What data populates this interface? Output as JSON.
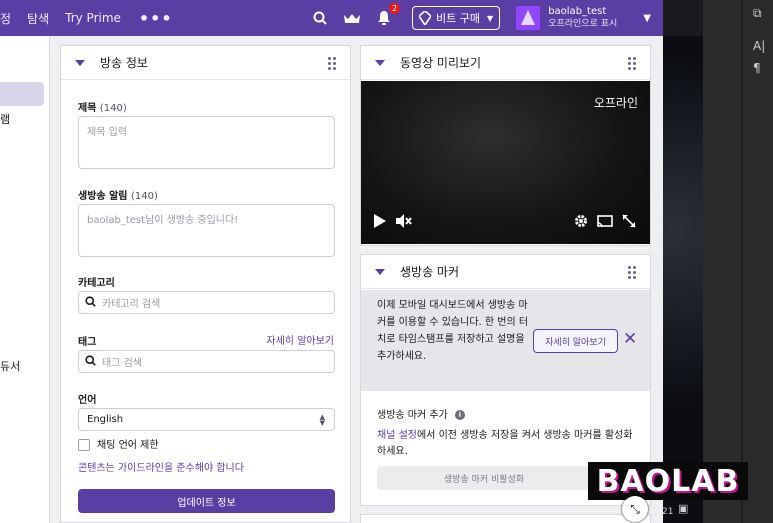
{
  "nav": {
    "left_links": [
      "정",
      "탐색",
      "Try Prime"
    ],
    "more": "•••",
    "notification_count": "2",
    "buy_bits_label": "비트 구매",
    "user_name": "baolab_test",
    "user_status": "오프라인으로 표시"
  },
  "sidebar": {
    "fragments": [
      "램",
      "듀서"
    ]
  },
  "stream_info": {
    "title": "방송 정보",
    "title_label": "제목",
    "title_count": "(140)",
    "title_placeholder": "제목 입력",
    "notify_label": "생방송 알림",
    "notify_count": "(140)",
    "notify_placeholder": "baolab_test님이 생방송 중입니다!",
    "category_label": "카테고리",
    "category_placeholder": "카테고리 검색",
    "tags_label": "태그",
    "tags_learn_more": "자세히 알아보기",
    "tags_placeholder": "태그 검색",
    "language_label": "언어",
    "language_value": "English",
    "chat_restrict_label": "채팅 언어 제한",
    "guidelines_text": "콘텐츠는 가이드라인을 준수해야 합니다",
    "update_button": "업데이트 정보"
  },
  "preview": {
    "title": "동영상 미리보기",
    "offline_label": "오프라인"
  },
  "markers": {
    "title": "생방송 마커",
    "notice_text": "이제 모바일 대시보드에서 생방송 마커를 이용할 수 있습니다. 한 번의 터치로 타임스탬프를 저장하고 설명을 추가하세요.",
    "learn_more_button": "자세히 알아보기",
    "add_label": "생방송 마커 추가",
    "desc_link": "채널 설정",
    "desc_text": "에서 이전 생방송 저장을 켜서 생방송 마커를 활성화하세요.",
    "disabled_button": "생방송 마커 비활성화"
  },
  "overlay": {
    "watermark": "BAOLAB",
    "ps_icons": [
      "⧉",
      "A|",
      "¶"
    ],
    "ps_bottom": "21"
  },
  "colors": {
    "brand": "#5a3ea3",
    "badge": "#e91916"
  }
}
